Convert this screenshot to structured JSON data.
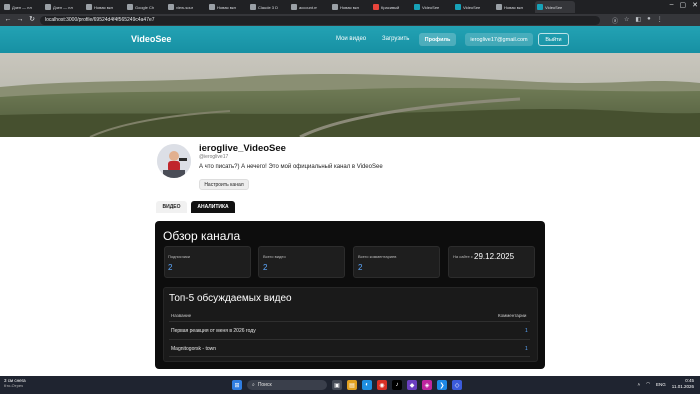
{
  "browser": {
    "tabs": [
      {
        "label": "Дзен — пл"
      },
      {
        "label": "Дзен — пл"
      },
      {
        "label": "Новая вкл"
      },
      {
        "label": "Google Ch"
      },
      {
        "label": "view-sour"
      },
      {
        "label": "Новая вкл"
      },
      {
        "label": "Claude 3 D"
      },
      {
        "label": "account.m"
      },
      {
        "label": "Новая вкл"
      },
      {
        "label": "Красивый"
      },
      {
        "label": "VideoSee"
      },
      {
        "label": "VideoSee"
      },
      {
        "label": "Новая вкл"
      },
      {
        "label": "VideoSee"
      }
    ],
    "url": "localhost:3000/profile/69524d4f4f565249c4a47e7"
  },
  "site": {
    "brand": "VideoSee",
    "nav": {
      "my_videos": "Мои видео",
      "upload": "Загрузить",
      "profile": "Профиль",
      "email": "ieroglive17@gmail.com",
      "logout": "Выйти"
    }
  },
  "profile": {
    "name": "ieroglive_VideoSee",
    "handle": "@ieroglive17",
    "bio": "А что писать?) А нечего! Это мой официальный канал в VideoSee",
    "configure_button": "Настроить канал",
    "tabs": {
      "video": "ВИДЕО",
      "analytics": "АНАЛИТИКА"
    }
  },
  "overview": {
    "title": "Обзор канала",
    "stats": [
      {
        "label": "Подписчики",
        "value": "2"
      },
      {
        "label": "Всего видео",
        "value": "2"
      },
      {
        "label": "Всего комментариев",
        "value": "2"
      }
    ],
    "since_label": "На сайте с",
    "since_value": "29.12.2025",
    "top": {
      "title": "Топ-5 обсуждаемых видео",
      "col_name": "Название",
      "col_comments": "Комментарии",
      "rows": [
        {
          "name": "Первая реакция от меня в 2026 году",
          "comments": "1"
        },
        {
          "name": "Magnitogorsk - town",
          "comments": "1"
        }
      ]
    }
  },
  "taskbar": {
    "weather_temp": "3 см снега",
    "weather_desc": "Кто-Отреч",
    "search": "Поиск",
    "lang": "ENG",
    "time": "0:45",
    "date": "11.01.2026"
  },
  "colors": {
    "accent": "#1c9cb0",
    "stat_value": "#5da9ff"
  }
}
